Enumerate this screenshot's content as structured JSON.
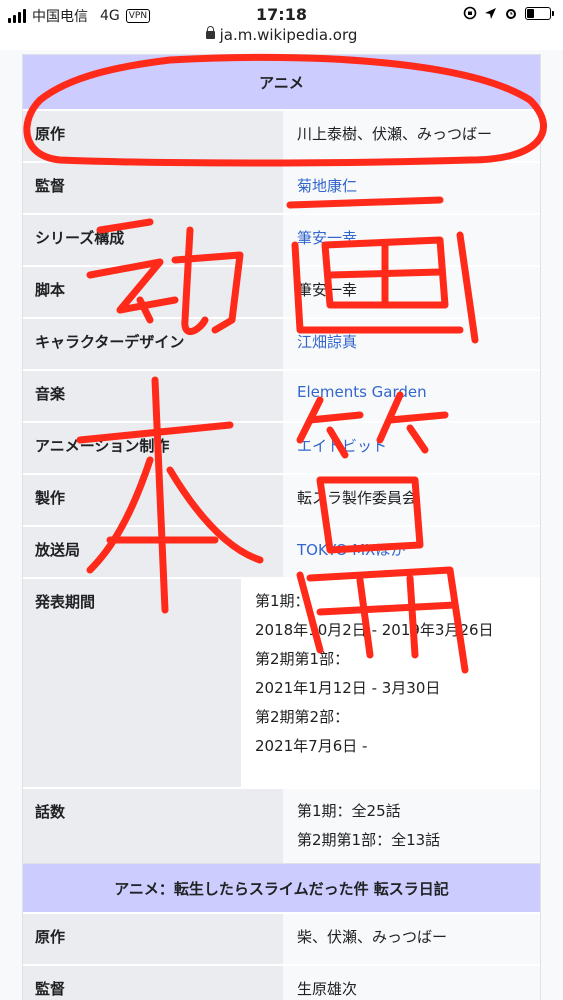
{
  "status_bar": {
    "carrier": "中国电信",
    "network": "4G",
    "vpn": "VPN",
    "time": "17:18"
  },
  "browser": {
    "url": "ja.m.wikipedia.org"
  },
  "infobox1": {
    "header": "アニメ",
    "rows": [
      {
        "label": "原作",
        "value": "川上泰樹、伏瀬、みっつばー"
      },
      {
        "label": "監督",
        "value": "菊地康仁"
      },
      {
        "label": "シリーズ構成",
        "value": "筆安一幸"
      },
      {
        "label": "脚本",
        "value": "筆安一幸"
      },
      {
        "label": "キャラクターデザイン",
        "value": "江畑諒真"
      },
      {
        "label": "音楽",
        "value": "Elements Garden"
      },
      {
        "label": "アニメーション制作",
        "value": "エイトビット"
      },
      {
        "label": "製作",
        "value": "転スラ製作委員会"
      },
      {
        "label": "放送局",
        "value": "TOKYO MXほか"
      }
    ],
    "period": {
      "label": "発表期間",
      "lines": [
        "第1期：",
        "2018年10月2日 - 2019年3月26日",
        "第2期第1部：",
        "2021年1月12日 - 3月30日",
        "第2期第2部：",
        "2021年7月6日 -"
      ]
    },
    "episodes": {
      "label": "話数",
      "lines": [
        "第1期：全25話",
        "第2期第1部：全13話"
      ]
    }
  },
  "infobox2": {
    "header": "アニメ：転生したらスライムだった件 転スラ日記",
    "rows": [
      {
        "label": "原作",
        "value": "柴、伏瀬、みっつばー"
      },
      {
        "label": "監督",
        "value": "生原雄次"
      }
    ]
  },
  "colors": {
    "header_bg": "#ccccff",
    "label_bg": "#eaecf0",
    "value_bg": "#f8f9fa",
    "link": "#3366cc",
    "annotation": "#ff2a1a"
  }
}
